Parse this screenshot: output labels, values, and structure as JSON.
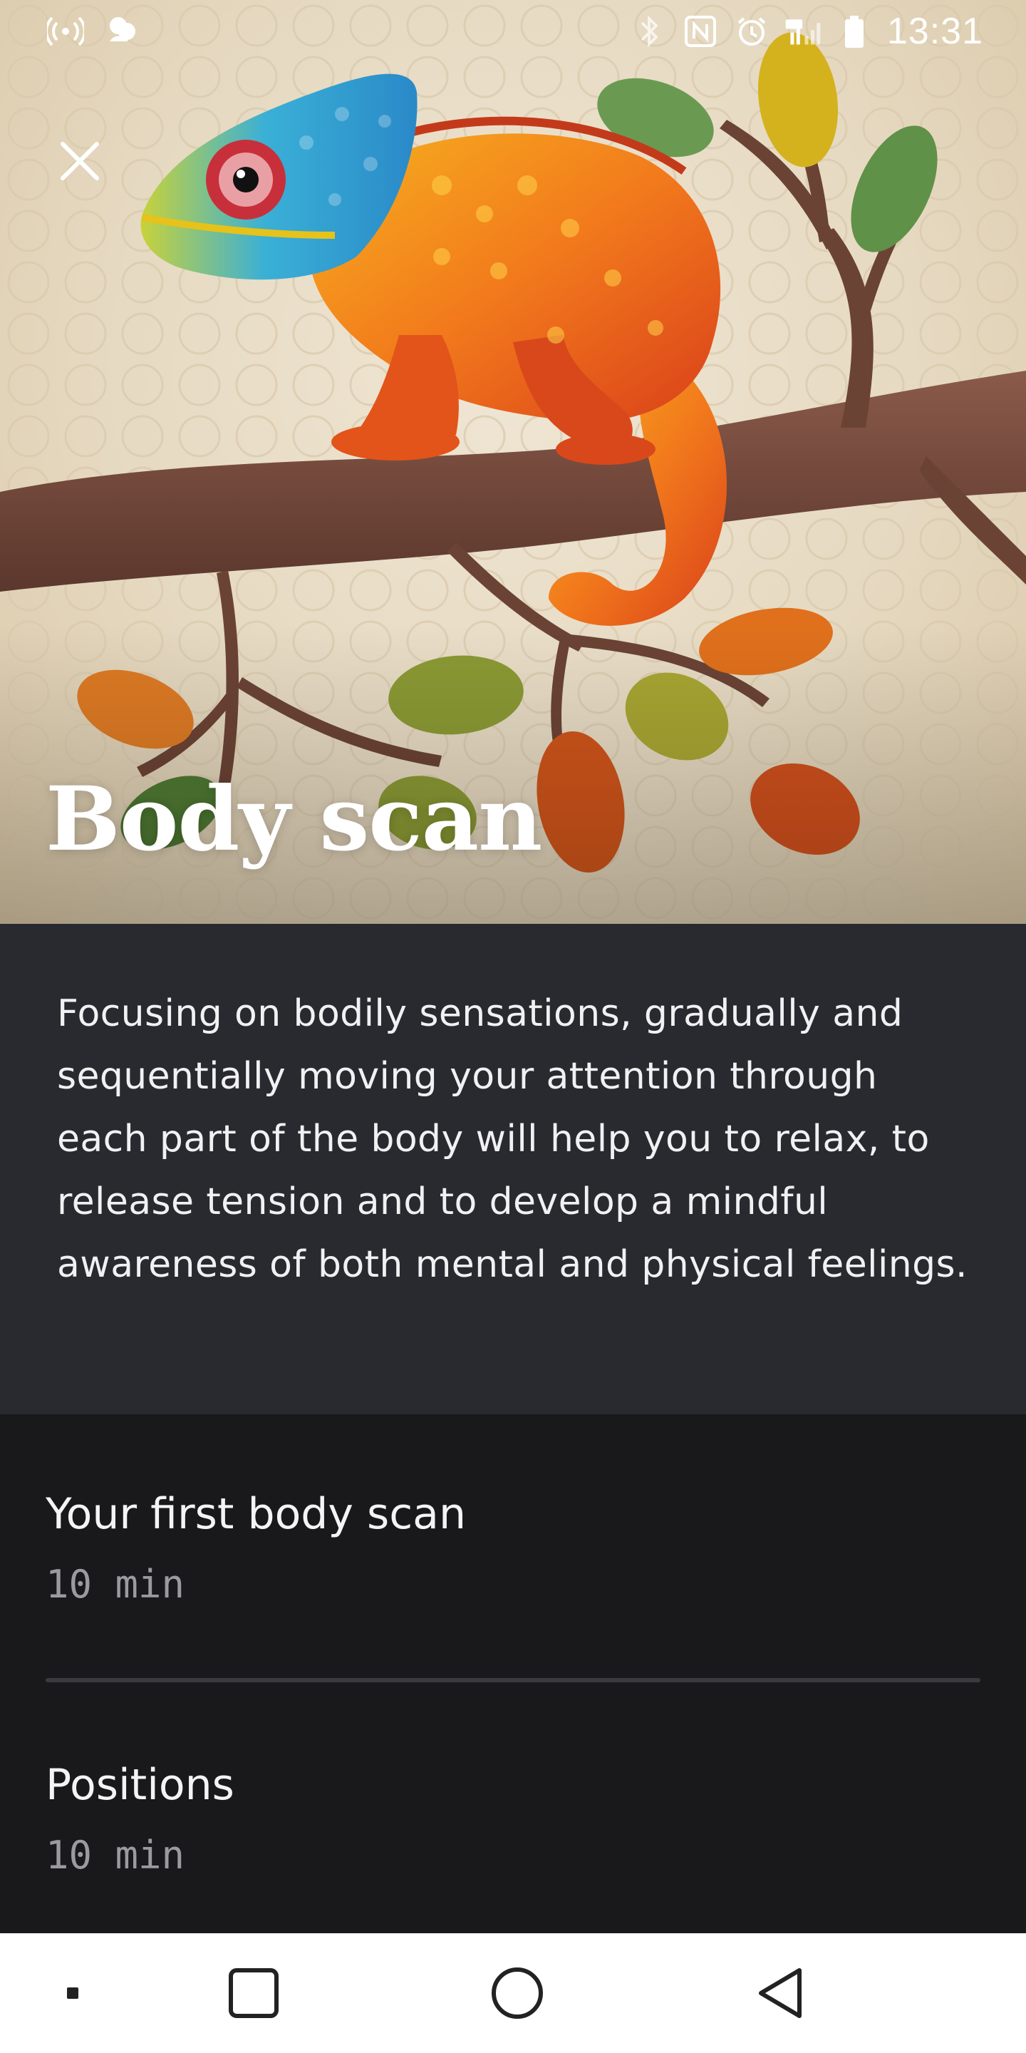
{
  "status_bar": {
    "time": "13:31",
    "left_icons": [
      "hotspot-icon",
      "app-notification-icon"
    ],
    "right_icons": [
      "bluetooth-icon",
      "nfc-icon",
      "alarm-icon",
      "signal-4g-icon",
      "battery-icon"
    ]
  },
  "hero": {
    "title": "Body scan",
    "close_icon": "close-icon"
  },
  "description": {
    "text": "Focusing on bodily sensations, gradually and sequentially moving your attention through each part of the body will help you to relax, to release tension and to develop a mindful awareness of both mental and physical feelings."
  },
  "sessions": [
    {
      "title": "Your first body scan",
      "duration": "10 min"
    },
    {
      "title": "Positions",
      "duration": "10 min"
    }
  ],
  "nav_bar": {
    "buttons": [
      "menu-dot-icon",
      "recents-icon",
      "home-icon",
      "back-icon"
    ]
  },
  "colors": {
    "description_bg": "#292930",
    "list_bg": "#19191b",
    "nav_bg": "#ffffff",
    "muted_text": "#9a9aa0",
    "chameleon_orange": "#f07a1c"
  }
}
